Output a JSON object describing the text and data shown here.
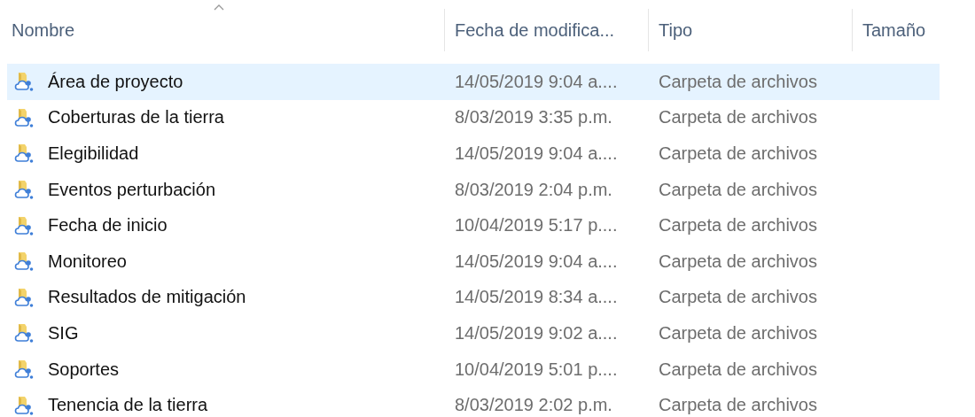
{
  "columns": [
    {
      "label": "Nombre",
      "sorted": true
    },
    {
      "label": "Fecha de modifica...",
      "sorted": false
    },
    {
      "label": "Tipo",
      "sorted": false
    },
    {
      "label": "Tamaño",
      "sorted": false
    }
  ],
  "rows": [
    {
      "name": "Área de proyecto",
      "modified": "14/05/2019 9:04 a....",
      "type": "Carpeta de archivos",
      "selected": true
    },
    {
      "name": "Coberturas de la tierra",
      "modified": "8/03/2019 3:35 p.m.",
      "type": "Carpeta de archivos",
      "selected": false
    },
    {
      "name": "Elegibilidad",
      "modified": "14/05/2019 9:04 a....",
      "type": "Carpeta de archivos",
      "selected": false
    },
    {
      "name": "Eventos perturbación",
      "modified": "8/03/2019 2:04 p.m.",
      "type": "Carpeta de archivos",
      "selected": false
    },
    {
      "name": "Fecha de inicio",
      "modified": "10/04/2019 5:17 p....",
      "type": "Carpeta de archivos",
      "selected": false
    },
    {
      "name": "Monitoreo",
      "modified": "14/05/2019 9:04 a....",
      "type": "Carpeta de archivos",
      "selected": false
    },
    {
      "name": "Resultados de mitigación",
      "modified": "14/05/2019 8:34 a....",
      "type": "Carpeta de archivos",
      "selected": false
    },
    {
      "name": "SIG",
      "modified": "14/05/2019 9:02 a....",
      "type": "Carpeta de archivos",
      "selected": false
    },
    {
      "name": "Soportes",
      "modified": "10/04/2019 5:01 p....",
      "type": "Carpeta de archivos",
      "selected": false
    },
    {
      "name": "Tenencia de la tierra",
      "modified": "8/03/2019 2:02 p.m.",
      "type": "Carpeta de archivos",
      "selected": false
    }
  ]
}
